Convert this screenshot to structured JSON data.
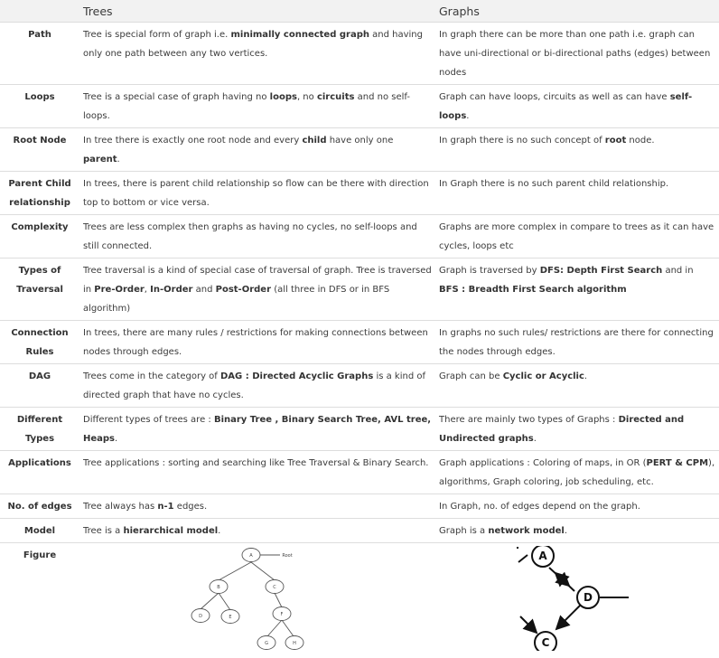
{
  "header": {
    "col1": "Trees",
    "col2": "Graphs"
  },
  "rows": [
    {
      "label": "Path",
      "tree": [
        {
          "t": "Tree is special form of graph i.e. "
        },
        {
          "t": "minimally connected graph",
          "b": true
        },
        {
          "t": " and having only one path between any two vertices."
        }
      ],
      "graph": [
        {
          "t": "In graph there can be more than one path i.e. graph can have uni-directional or bi-directional paths (edges) between nodes"
        }
      ]
    },
    {
      "label": "Loops",
      "tree": [
        {
          "t": "Tree is a special case of graph having no "
        },
        {
          "t": "loops",
          "b": true
        },
        {
          "t": ", no "
        },
        {
          "t": "circuits",
          "b": true
        },
        {
          "t": " and no self-loops."
        }
      ],
      "graph": [
        {
          "t": "Graph can have loops, circuits as well as can have "
        },
        {
          "t": "self-loops",
          "b": true
        },
        {
          "t": "."
        }
      ]
    },
    {
      "label": "Root Node",
      "tree": [
        {
          "t": "In tree there is exactly one root node and every "
        },
        {
          "t": "child",
          "b": true
        },
        {
          "t": " have only one "
        },
        {
          "t": "parent",
          "b": true
        },
        {
          "t": "."
        }
      ],
      "graph": [
        {
          "t": "In graph there is no such concept of "
        },
        {
          "t": "root",
          "b": true
        },
        {
          "t": " node."
        }
      ]
    },
    {
      "label": "Parent Child relationship",
      "tree": [
        {
          "t": "In trees, there is parent child relationship so flow can be there with direction top to bottom or vice versa."
        }
      ],
      "graph": [
        {
          "t": "In Graph there is no such parent child relationship."
        }
      ]
    },
    {
      "label": "Complexity",
      "tree": [
        {
          "t": "Trees are less complex then graphs as having no cycles, no self-loops and still connected."
        }
      ],
      "graph": [
        {
          "t": "Graphs are more complex in compare to trees as it can have cycles, loops etc"
        }
      ]
    },
    {
      "label": "Types of Traversal",
      "tree": [
        {
          "t": "Tree traversal is a kind of special case of traversal of graph. Tree is traversed in "
        },
        {
          "t": "Pre-Order",
          "b": true
        },
        {
          "t": ", "
        },
        {
          "t": "In-Order",
          "b": true
        },
        {
          "t": " and "
        },
        {
          "t": "Post-Order",
          "b": true
        },
        {
          "t": " (all three in DFS or in BFS algorithm)"
        }
      ],
      "graph": [
        {
          "t": "Graph is traversed by "
        },
        {
          "t": "DFS: Depth First Search",
          "b": true
        },
        {
          "t": " and in "
        },
        {
          "t": "BFS : Breadth First Search algorithm",
          "b": true
        }
      ]
    },
    {
      "label": "Connection Rules",
      "tree": [
        {
          "t": "In trees, there are many rules / restrictions for making connections between nodes through edges."
        }
      ],
      "graph": [
        {
          "t": "In graphs no such rules/ restrictions are there for connecting the nodes through edges."
        }
      ]
    },
    {
      "label": "DAG",
      "tree": [
        {
          "t": "Trees come in the category of "
        },
        {
          "t": "DAG : Directed Acyclic Graphs",
          "b": true
        },
        {
          "t": " is a kind of directed graph that have no cycles."
        }
      ],
      "graph": [
        {
          "t": "Graph can be "
        },
        {
          "t": "Cyclic or Acyclic",
          "b": true
        },
        {
          "t": "."
        }
      ]
    },
    {
      "label": "Different Types",
      "tree": [
        {
          "t": "Different types of trees are : "
        },
        {
          "t": "Binary Tree , Binary Search Tree, AVL tree, Heaps",
          "b": true
        },
        {
          "t": "."
        }
      ],
      "graph": [
        {
          "t": "There are mainly two types of Graphs : "
        },
        {
          "t": "Directed and Undirected graphs",
          "b": true
        },
        {
          "t": "."
        }
      ]
    },
    {
      "label": "Applications",
      "tree": [
        {
          "t": "Tree applications : sorting and searching like Tree Traversal & Binary Search."
        }
      ],
      "graph": [
        {
          "t": "Graph applications : Coloring of maps, in OR ("
        },
        {
          "t": "PERT & CPM",
          "b": true
        },
        {
          "t": "), algorithms, Graph coloring, job scheduling, etc."
        }
      ]
    },
    {
      "label": "No. of edges",
      "tree": [
        {
          "t": "Tree always has "
        },
        {
          "t": "n-1",
          "b": true
        },
        {
          "t": " edges."
        }
      ],
      "graph": [
        {
          "t": "In Graph, no. of edges depend on the graph."
        }
      ]
    },
    {
      "label": "Model",
      "tree": [
        {
          "t": "Tree is a "
        },
        {
          "t": "hierarchical model",
          "b": true
        },
        {
          "t": "."
        }
      ],
      "graph": [
        {
          "t": "Graph is a "
        },
        {
          "t": "network model",
          "b": true
        },
        {
          "t": "."
        }
      ]
    }
  ],
  "figure_row": {
    "label": "Figure",
    "tree_fig": {
      "nodes": [
        "A",
        "B",
        "C",
        "D",
        "E",
        "F",
        "G",
        "H"
      ],
      "root_label": "Root"
    },
    "graph_fig": {
      "nodes": [
        "A",
        "D",
        "C"
      ]
    }
  }
}
